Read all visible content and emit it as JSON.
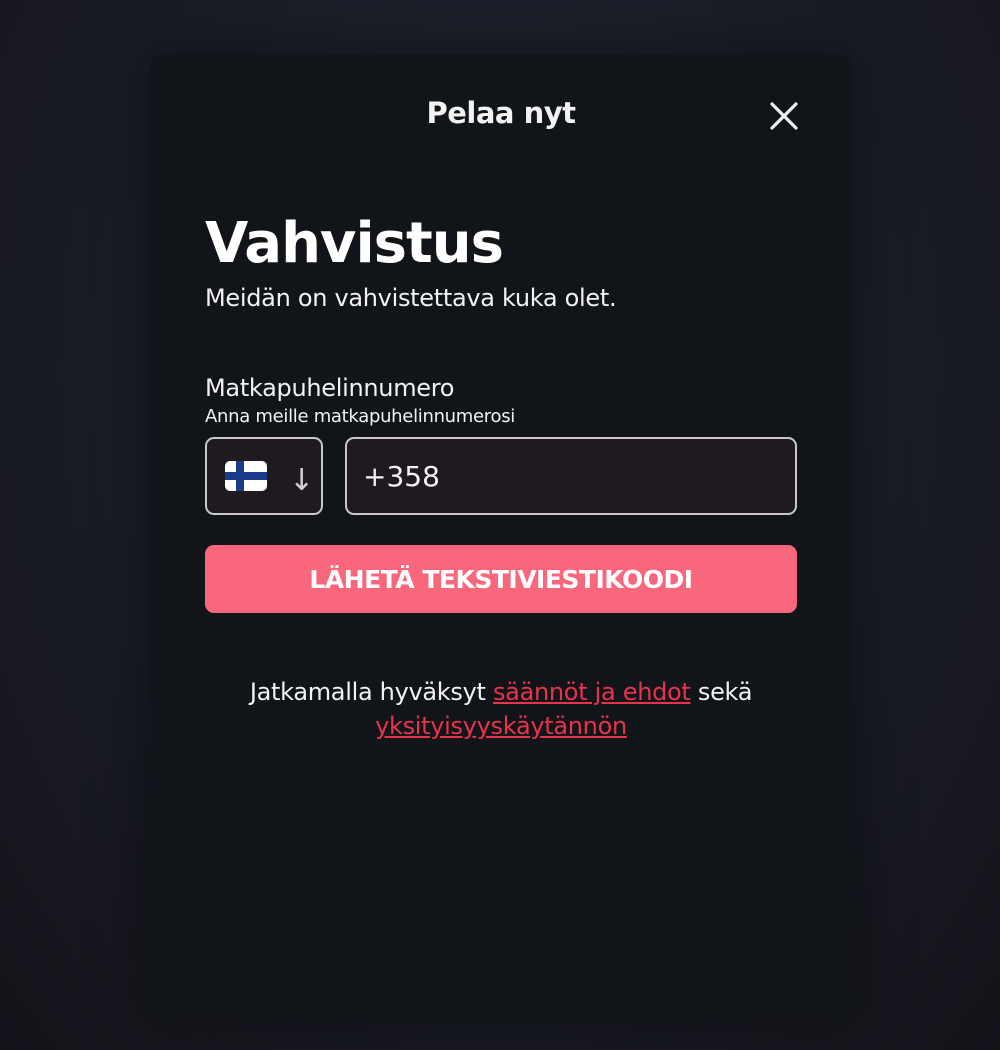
{
  "modal": {
    "title": "Pelaa nyt"
  },
  "verification": {
    "heading": "Vahvistus",
    "subheading": "Meidän on vahvistettava kuka olet."
  },
  "phone_field": {
    "label": "Matkapuhelinnumero",
    "hint": "Anna meille matkapuhelinnumerosi",
    "country_icon": "finland-flag-icon",
    "dropdown_glyph": "↓",
    "value": "+358"
  },
  "submit": {
    "label": "LÄHETÄ TEKSTIVIESTIKOODI"
  },
  "terms": {
    "prefix": "Jatkamalla hyväksyt",
    "terms_link": "säännöt ja ehdot",
    "middle": "sekä",
    "privacy_link": "yksityisyyskäytännön"
  },
  "colors": {
    "accent": "#f9677c",
    "link": "#e8334d",
    "modal_bg": "#111418"
  }
}
